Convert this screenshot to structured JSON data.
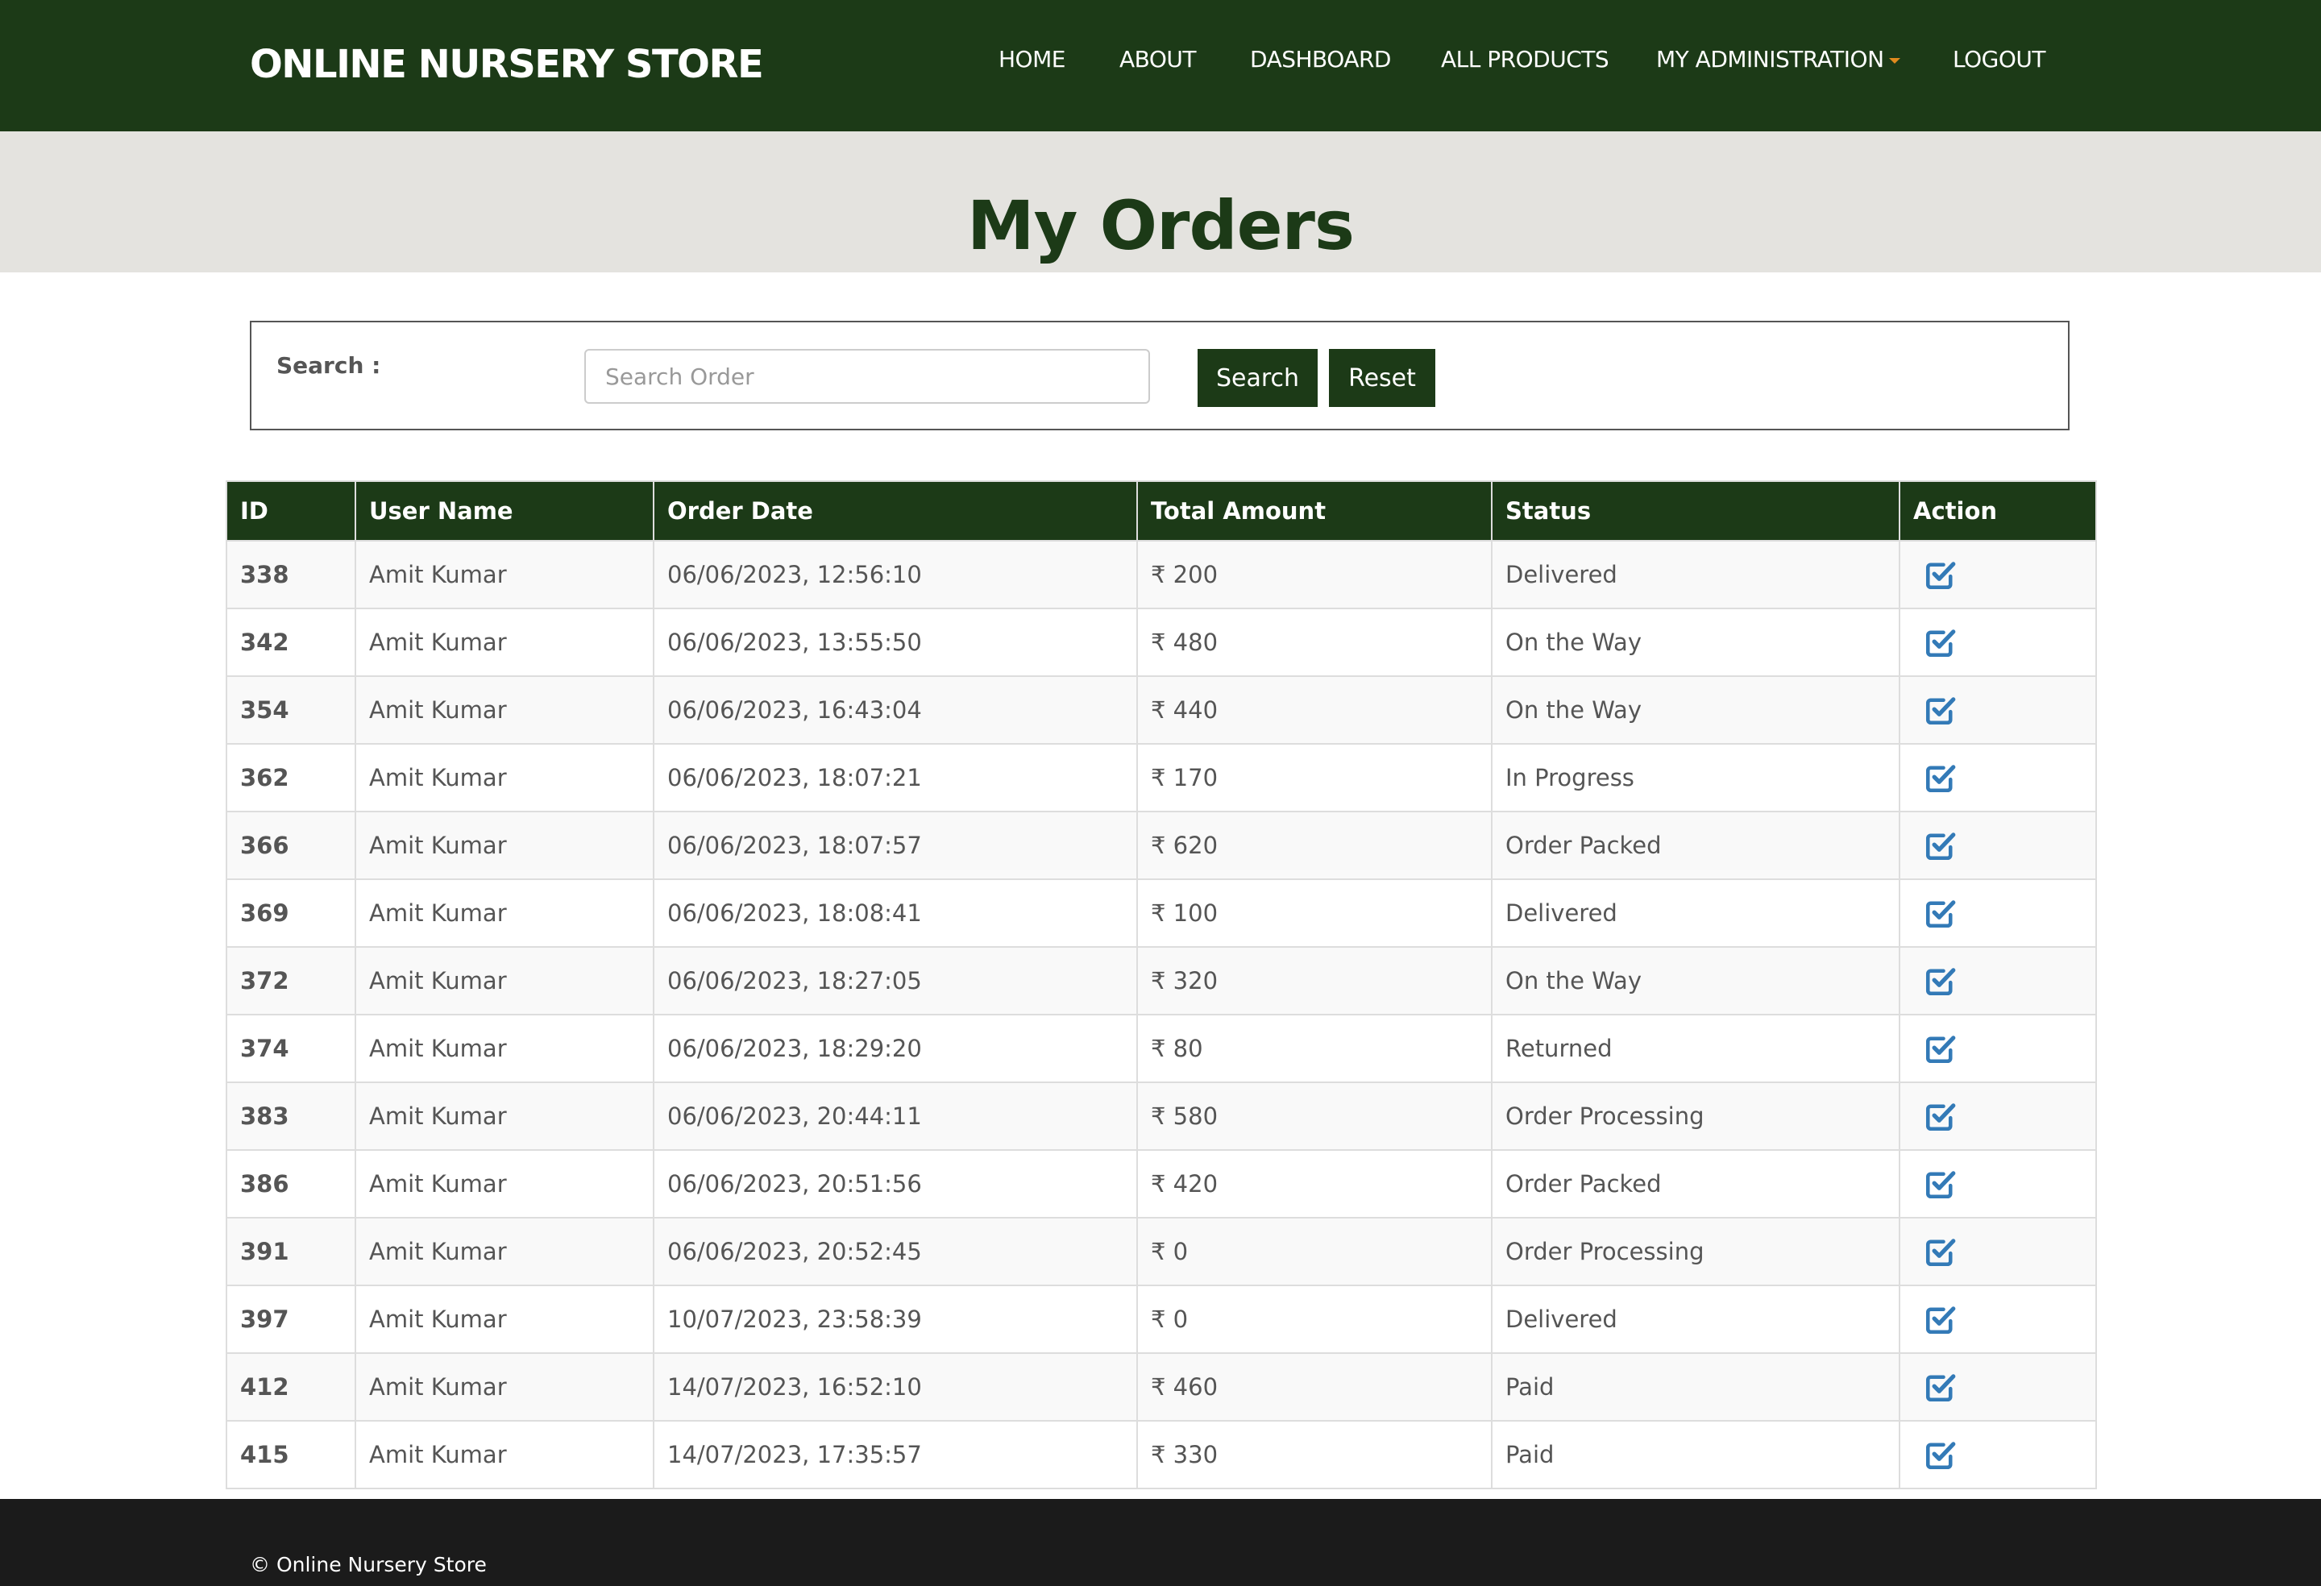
{
  "brand": "ONLINE NURSERY STORE",
  "nav": {
    "home": "HOME",
    "about": "ABOUT",
    "dashboard": "DASHBOARD",
    "all_products": "ALL PRODUCTS",
    "my_administration": "MY ADMINISTRATION",
    "logout": "LOGOUT"
  },
  "page_title": "My Orders",
  "search": {
    "label": "Search :",
    "placeholder": "Search Order",
    "value": "",
    "search_button": "Search",
    "reset_button": "Reset"
  },
  "table": {
    "headers": [
      "ID",
      "User Name",
      "Order Date",
      "Total Amount",
      "Status",
      "Action"
    ],
    "rows": [
      {
        "id": "338",
        "user": "Amit Kumar",
        "date": "06/06/2023, 12:56:10",
        "amount": "₹ 200",
        "status": "Delivered",
        "action_icon": "check-square-icon"
      },
      {
        "id": "342",
        "user": "Amit Kumar",
        "date": "06/06/2023, 13:55:50",
        "amount": "₹ 480",
        "status": "On the Way",
        "action_icon": "check-square-icon"
      },
      {
        "id": "354",
        "user": "Amit Kumar",
        "date": "06/06/2023, 16:43:04",
        "amount": "₹ 440",
        "status": "On the Way",
        "action_icon": "check-square-icon"
      },
      {
        "id": "362",
        "user": "Amit Kumar",
        "date": "06/06/2023, 18:07:21",
        "amount": "₹ 170",
        "status": "In Progress",
        "action_icon": "check-square-icon"
      },
      {
        "id": "366",
        "user": "Amit Kumar",
        "date": "06/06/2023, 18:07:57",
        "amount": "₹ 620",
        "status": "Order Packed",
        "action_icon": "check-square-icon"
      },
      {
        "id": "369",
        "user": "Amit Kumar",
        "date": "06/06/2023, 18:08:41",
        "amount": "₹ 100",
        "status": "Delivered",
        "action_icon": "check-square-icon"
      },
      {
        "id": "372",
        "user": "Amit Kumar",
        "date": "06/06/2023, 18:27:05",
        "amount": "₹ 320",
        "status": "On the Way",
        "action_icon": "check-square-icon"
      },
      {
        "id": "374",
        "user": "Amit Kumar",
        "date": "06/06/2023, 18:29:20",
        "amount": "₹ 80",
        "status": "Returned",
        "action_icon": "check-square-icon"
      },
      {
        "id": "383",
        "user": "Amit Kumar",
        "date": "06/06/2023, 20:44:11",
        "amount": "₹ 580",
        "status": "Order Processing",
        "action_icon": "check-square-icon"
      },
      {
        "id": "386",
        "user": "Amit Kumar",
        "date": "06/06/2023, 20:51:56",
        "amount": "₹ 420",
        "status": "Order Packed",
        "action_icon": "check-square-icon"
      },
      {
        "id": "391",
        "user": "Amit Kumar",
        "date": "06/06/2023, 20:52:45",
        "amount": "₹ 0",
        "status": "Order Processing",
        "action_icon": "check-square-icon"
      },
      {
        "id": "397",
        "user": "Amit Kumar",
        "date": "10/07/2023, 23:58:39",
        "amount": "₹ 0",
        "status": "Delivered",
        "action_icon": "check-square-icon"
      },
      {
        "id": "412",
        "user": "Amit Kumar",
        "date": "14/07/2023, 16:52:10",
        "amount": "₹ 460",
        "status": "Paid",
        "action_icon": "check-square-icon"
      },
      {
        "id": "415",
        "user": "Amit Kumar",
        "date": "14/07/2023, 17:35:57",
        "amount": "₹ 330",
        "status": "Paid",
        "action_icon": "check-square-icon"
      }
    ]
  },
  "footer": "© Online Nursery Store",
  "colors": {
    "primary": "#1c3a17",
    "banner": "#e4e3df",
    "footer": "#1b1b1b",
    "icon": "#337ab7",
    "caret": "#e08a1e"
  }
}
